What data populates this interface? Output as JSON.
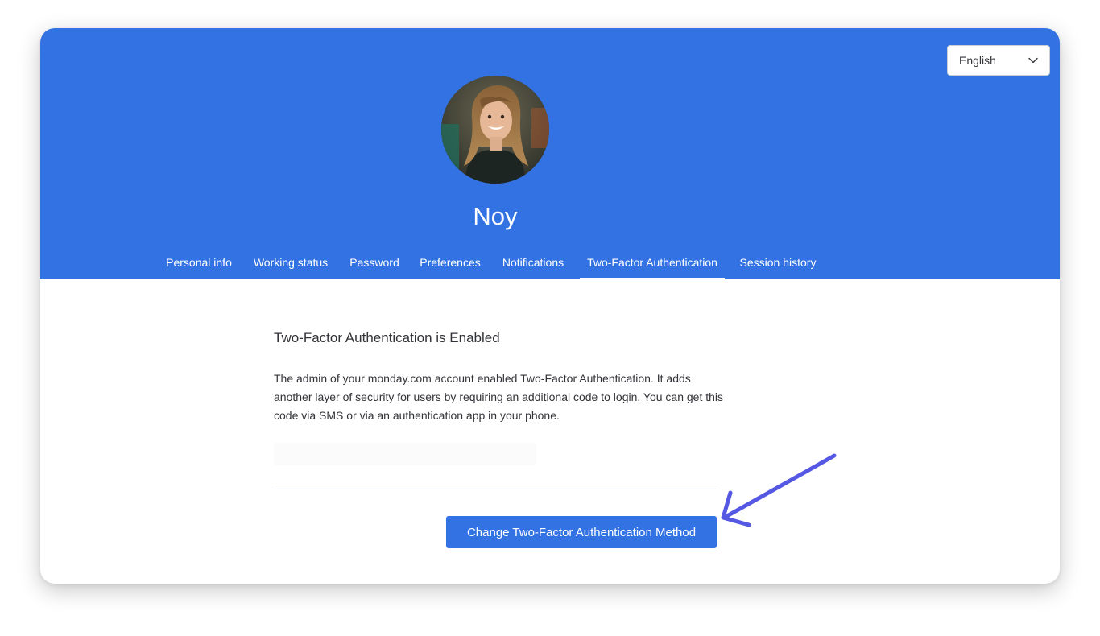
{
  "language_select": {
    "selected": "English",
    "icon": "chevron-down-icon"
  },
  "profile": {
    "name": "Noy",
    "avatar_icon": "avatar-photo"
  },
  "tabs": [
    {
      "label": "Personal info",
      "active": false
    },
    {
      "label": "Working status",
      "active": false
    },
    {
      "label": "Password",
      "active": false
    },
    {
      "label": "Preferences",
      "active": false
    },
    {
      "label": "Notifications",
      "active": false
    },
    {
      "label": "Two-Factor Authentication",
      "active": true
    },
    {
      "label": "Session history",
      "active": false
    }
  ],
  "two_factor": {
    "title": "Two-Factor Authentication is Enabled",
    "description": "The admin of your monday.com account enabled Two-Factor Authentication. It adds another layer of security for users by requiring an additional code to login. You can get this code via SMS or via an authentication app in your phone.",
    "change_button_label": "Change Two-Factor Authentication Method"
  },
  "colors": {
    "header_blue": "#3372e3",
    "annotation_arrow": "#5558e3"
  }
}
